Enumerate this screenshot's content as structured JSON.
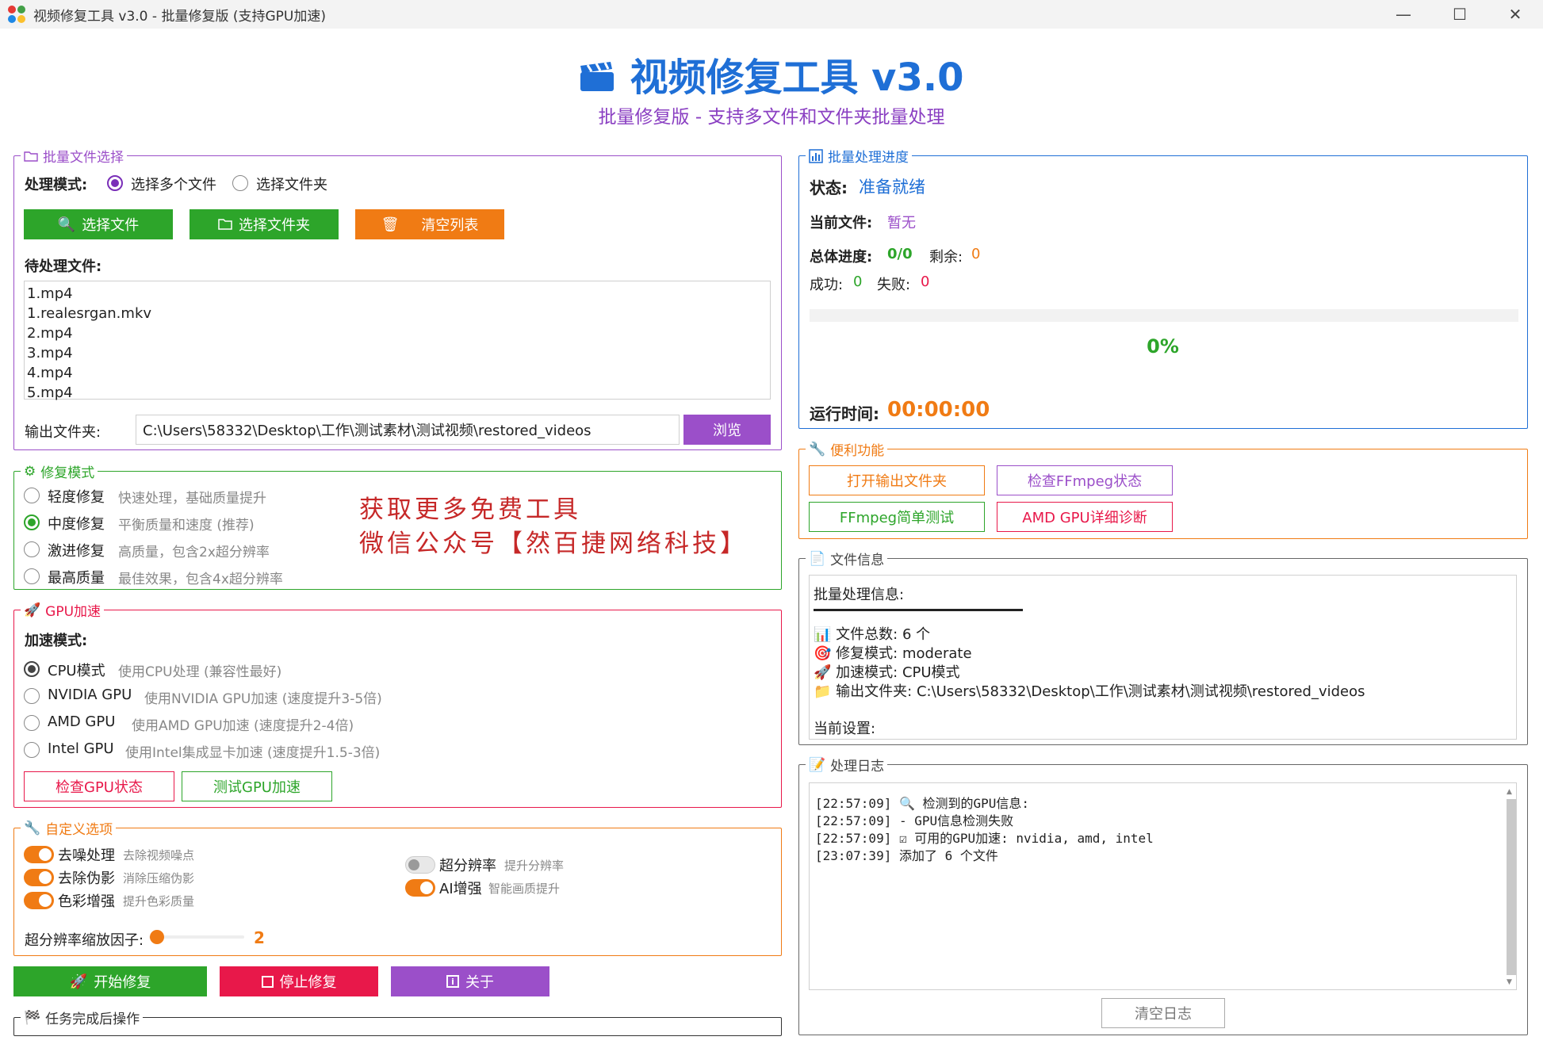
{
  "window": {
    "title": "视频修复工具 v3.0 - 批量修复版 (支持GPU加速)",
    "minimize_glyph": "—",
    "maximize_glyph": "☐",
    "close_glyph": "✕"
  },
  "header": {
    "title": "视频修复工具 v3.0",
    "subtitle": "批量修复版 - 支持多文件和文件夹批量处理"
  },
  "batch_files": {
    "legend": "批量文件选择",
    "mode_label": "处理模式:",
    "mode_options": [
      "选择多个文件",
      "选择文件夹"
    ],
    "selected_mode": "选择多个文件",
    "select_files_btn": "选择文件",
    "select_folder_btn": "选择文件夹",
    "clear_list_btn": "清空列表",
    "pending_label": "待处理文件:",
    "files": [
      "1.mp4",
      "1.realesrgan.mkv",
      "2.mp4",
      "3.mp4",
      "4.mp4",
      "5.mp4"
    ],
    "output_label": "输出文件夹:",
    "output_path": "C:\\Users\\58332\\Desktop\\工作\\测试素材\\测试视频\\restored_videos",
    "browse_btn": "浏览"
  },
  "repair_mode": {
    "legend": "修复模式",
    "options": [
      {
        "label": "轻度修复",
        "desc": "快速处理，基础质量提升"
      },
      {
        "label": "中度修复",
        "desc": "平衡质量和速度 (推荐)"
      },
      {
        "label": "激进修复",
        "desc": "高质量，包含2x超分辨率"
      },
      {
        "label": "最高质量",
        "desc": "最佳效果，包含4x超分辨率"
      }
    ],
    "selected": "中度修复",
    "watermark_line1": "获取更多免费工具",
    "watermark_line2": "微信公众号【然百捷网络科技】"
  },
  "gpu": {
    "legend": "GPU加速",
    "mode_label": "加速模式:",
    "options": [
      {
        "label": "CPU模式",
        "desc": "使用CPU处理 (兼容性最好)"
      },
      {
        "label": "NVIDIA GPU",
        "desc": "使用NVIDIA GPU加速 (速度提升3-5倍)"
      },
      {
        "label": "AMD GPU",
        "desc": "使用AMD GPU加速 (速度提升2-4倍)"
      },
      {
        "label": "Intel GPU",
        "desc": "使用Intel集成显卡加速 (速度提升1.5-3倍)"
      }
    ],
    "selected": "CPU模式",
    "check_btn": "检查GPU状态",
    "test_btn": "测试GPU加速"
  },
  "custom": {
    "legend": "自定义选项",
    "toggles": [
      {
        "label": "去噪处理",
        "desc": "去除视频噪点",
        "on": true
      },
      {
        "label": "去除伪影",
        "desc": "消除压缩伪影",
        "on": true
      },
      {
        "label": "色彩增强",
        "desc": "提升色彩质量",
        "on": true
      },
      {
        "label": "超分辨率",
        "desc": "提升分辨率",
        "on": false
      },
      {
        "label": "AI增强",
        "desc": "智能画质提升",
        "on": true
      }
    ],
    "scale_label": "超分辨率缩放因子:",
    "scale_value": "2"
  },
  "actions": {
    "start_btn": "开始修复",
    "stop_btn": "停止修复",
    "about_btn": "关于"
  },
  "after_task": {
    "legend": "任务完成后操作"
  },
  "progress": {
    "legend": "批量处理进度",
    "status_label": "状态:",
    "status_value": "准备就绪",
    "current_label": "当前文件:",
    "current_value": "暂无",
    "overall_label": "总体进度:",
    "overall_value": "0/0",
    "remaining_label": "剩余:",
    "remaining_value": "0",
    "success_label": "成功:",
    "success_value": "0",
    "fail_label": "失败:",
    "fail_value": "0",
    "percent": "0%",
    "fraction": 0,
    "runtime_label": "运行时间:",
    "runtime_value": "00:00:00"
  },
  "utilities": {
    "legend": "便利功能",
    "open_output_btn": "打开输出文件夹",
    "check_ffmpeg_btn": "检查FFmpeg状态",
    "ffmpeg_test_btn": "FFmpeg简单测试",
    "amd_diag_btn": "AMD GPU详细诊断"
  },
  "file_info": {
    "legend": "文件信息",
    "heading": "批量处理信息:",
    "total": "文件总数: 6 个",
    "mode": "修复模式: moderate",
    "accel": "加速模式: CPU模式",
    "output": "输出文件夹: C:\\Users\\58332\\Desktop\\工作\\测试素材\\测试视频\\restored_videos",
    "current_settings": "当前设置:"
  },
  "log": {
    "legend": "处理日志",
    "lines": [
      {
        "time": "[22:57:09]",
        "text": "🔍 检测到的GPU信息:"
      },
      {
        "time": "[22:57:09]",
        "text": "  - GPU信息检测失败"
      },
      {
        "time": "[22:57:09]",
        "text": "☑ 可用的GPU加速: nvidia, amd, intel"
      },
      {
        "time": "[23:07:39]",
        "text": "添加了 6 个文件"
      }
    ],
    "clear_btn": "清空日志"
  },
  "colors": {
    "green": "#2da52a",
    "orange": "#f07b14",
    "purple": "#9b4fc9",
    "red": "#e8184a",
    "blue": "#1f6fd6"
  }
}
